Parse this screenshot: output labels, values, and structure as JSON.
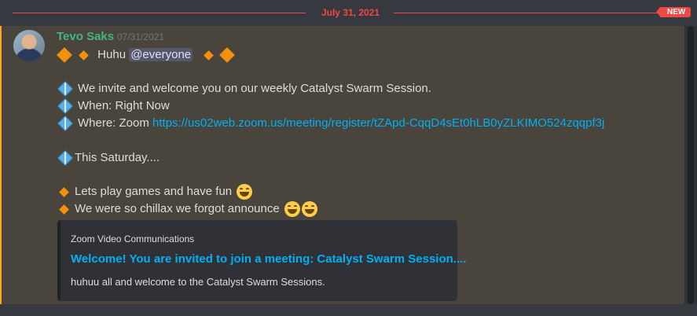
{
  "divider": {
    "date": "July 31, 2021",
    "badge": "NEW"
  },
  "message": {
    "author": "Tevo Saks",
    "timestamp": "07/31/2021",
    "greeting": "Huhu",
    "mention": "@everyone",
    "invite_line": "We invite and welcome you on our weekly Catalyst Swarm Session.",
    "when_line": "When: Right Now",
    "where_prefix": "Where: Zoom ",
    "where_link": "https://us02web.zoom.us/meeting/register/tZApd-CqqD4sEt0hLB0yZLKIMO524zqqpf3j",
    "saturday_line": "This Saturday....",
    "games_line": "Lets play games and have fun",
    "chillax_line": "We were so chillax we forgot announce"
  },
  "embed": {
    "provider": "Zoom Video Communications",
    "title": "Welcome! You are invited to join a meeting: Catalyst Swarm Session....",
    "description": "huhuu all and welcome to the Catalyst Swarm Sessions."
  },
  "colors": {
    "mention_highlight": "#faa61a",
    "username": "#43b581",
    "link": "#00b0f4",
    "new_badge": "#f04747"
  },
  "icons": [
    "orange-diamond-icon",
    "blue-diamond-icon",
    "grinning-emoji-icon"
  ]
}
